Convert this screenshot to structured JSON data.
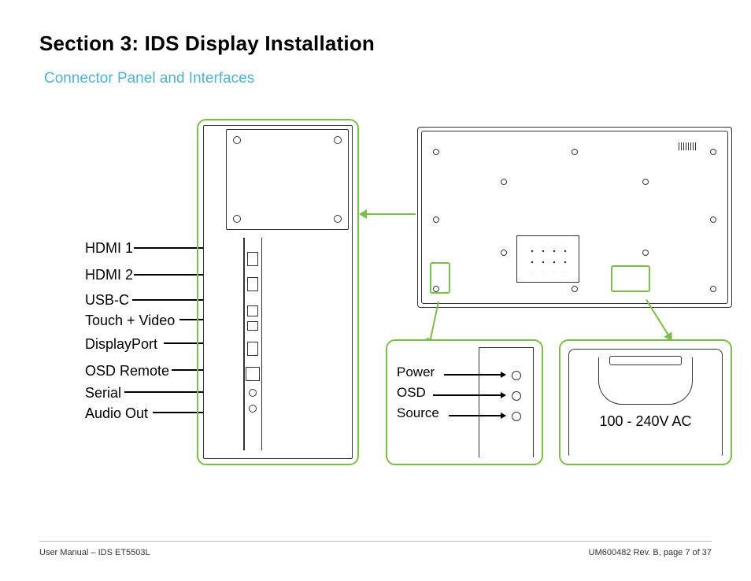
{
  "heading": "Section 3: IDS Display Installation",
  "subheading": "Connector Panel and Interfaces",
  "left_labels": {
    "hdmi1": "HDMI 1",
    "hdmi2": "HDMI 2",
    "usbc": "USB-C",
    "touchvideo": "Touch + Video",
    "displayport": "DisplayPort",
    "osdremote": "OSD Remote",
    "serial": "Serial",
    "audioout": "Audio Out"
  },
  "osd_labels": {
    "power": "Power",
    "osd": "OSD",
    "source": "Source"
  },
  "power_label": "100 - 240V AC",
  "footer_left": "User Manual – IDS ET5503L",
  "footer_right": "UM600482 Rev. B, page 7 of 37"
}
